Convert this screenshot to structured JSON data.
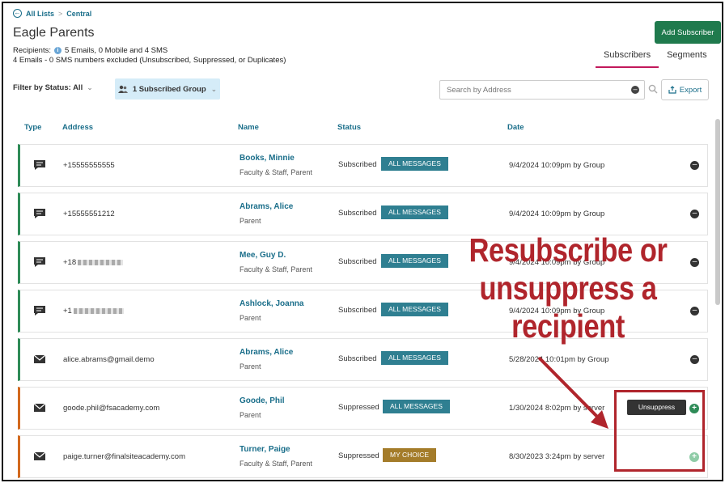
{
  "breadcrumb": {
    "all_lists": "All Lists",
    "separator": ">",
    "current": "Central"
  },
  "page": {
    "title": "Eagle Parents",
    "recipients_label": "Recipients:",
    "recipients_summary": "5 Emails, 0 Mobile and 4 SMS",
    "excluded_summary": "4 Emails - 0 SMS numbers excluded (Unsubscribed, Suppressed, or Duplicates)"
  },
  "actions": {
    "add_subscriber": "Add Subscriber",
    "export": "Export"
  },
  "tabs": [
    {
      "label": "Subscribers",
      "active": true
    },
    {
      "label": "Segments",
      "active": false
    }
  ],
  "filters": {
    "status_filter": "Filter by Status: All",
    "group_filter": "1 Subscribed Group",
    "search_placeholder": "Search by Address"
  },
  "table": {
    "columns": [
      "Type",
      "Address",
      "Name",
      "Status",
      "Date"
    ],
    "rows": [
      {
        "type": "sms",
        "address": "+15555555555",
        "name": "Books, Minnie",
        "role": "Faculty & Staff, Parent",
        "status": "Subscribed",
        "badge": "ALL MESSAGES",
        "date": "9/4/2024 10:09pm by Group",
        "action": "remove"
      },
      {
        "type": "sms",
        "address": "+15555551212",
        "name": "Abrams, Alice",
        "role": "Parent",
        "status": "Subscribed",
        "badge": "ALL MESSAGES",
        "date": "9/4/2024 10:09pm by Group",
        "action": "remove"
      },
      {
        "type": "sms",
        "address": "+18",
        "name": "Mee, Guy D.",
        "role": "Faculty & Staff, Parent",
        "status": "Subscribed",
        "badge": "ALL MESSAGES",
        "date": "9/4/2024 10:09pm by Group",
        "action": "remove"
      },
      {
        "type": "sms",
        "address": "+1",
        "name": "Ashlock, Joanna",
        "role": "Parent",
        "status": "Subscribed",
        "badge": "ALL MESSAGES",
        "date": "9/4/2024 10:09pm by Group",
        "action": "remove"
      },
      {
        "type": "email",
        "address": "alice.abrams@gmail.demo",
        "name": "Abrams, Alice",
        "role": "Parent",
        "status": "Subscribed",
        "badge": "ALL MESSAGES",
        "date": "5/28/2024 10:01pm by Group",
        "action": "remove"
      },
      {
        "type": "email",
        "address": "goode.phil@fsacademy.com",
        "name": "Goode, Phil",
        "role": "Parent",
        "status": "Suppressed",
        "badge": "ALL MESSAGES",
        "date": "1/30/2024 8:02pm by server",
        "action": "add",
        "hover_button": "Unsuppress"
      },
      {
        "type": "email",
        "address": "paige.turner@finalsiteacademy.com",
        "name": "Turner, Paige",
        "role": "Faculty & Staff, Parent",
        "status": "Suppressed",
        "badge": "MY CHOICE",
        "date": "8/30/2023 3:24pm by server",
        "action": "add"
      }
    ]
  },
  "annotation": {
    "callout_lines": [
      "Resubscribe or",
      "unsuppress a",
      "recipient"
    ],
    "color": "#b0252c"
  },
  "colors": {
    "accent_teal": "#1a6e8a",
    "add_button": "#1f7a4d",
    "badge_all_messages": "#2f7f91",
    "badge_my_choice": "#a47c2a",
    "subscribed_bar": "#2e8b57",
    "suppressed_bar": "#d2691e"
  }
}
